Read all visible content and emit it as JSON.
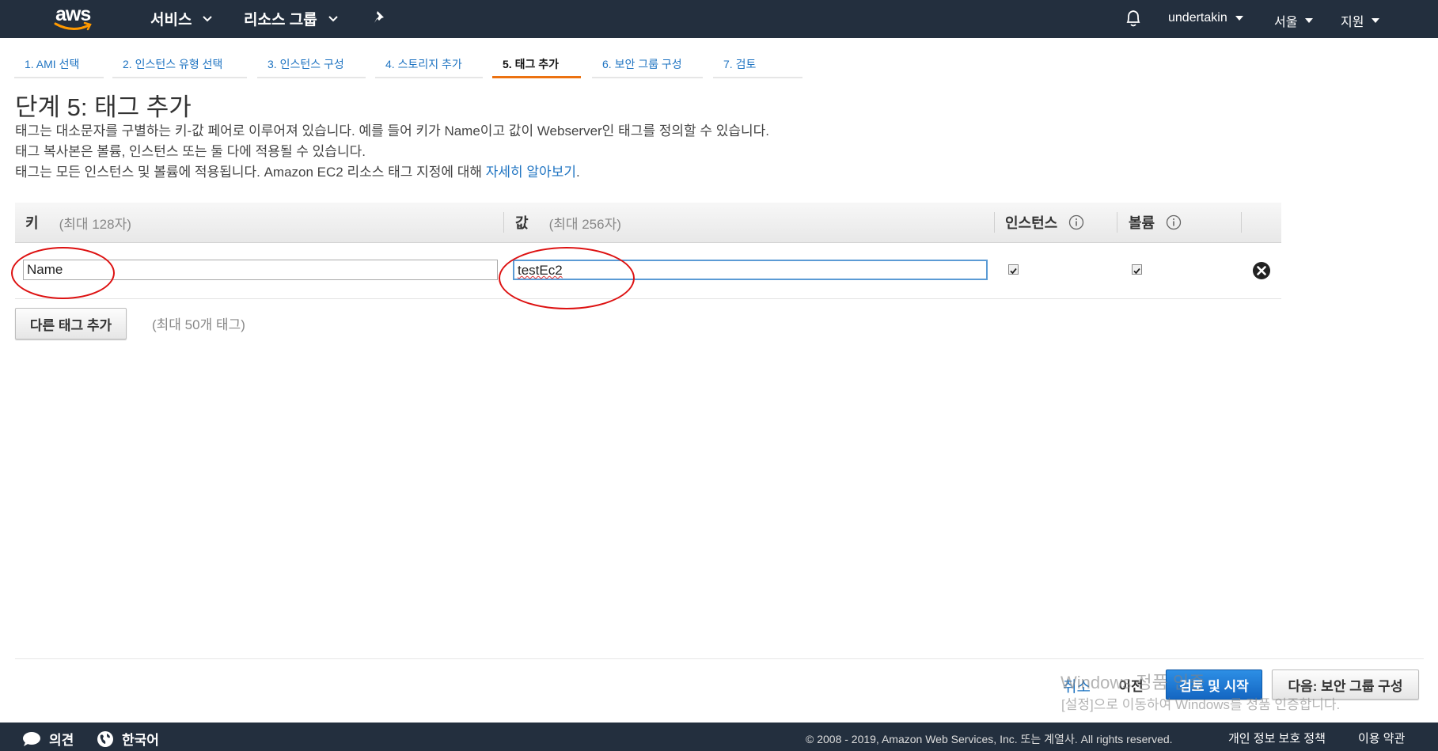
{
  "nav": {
    "brand": "aws",
    "services": "서비스",
    "resource_groups": "리소스 그룹",
    "user": "undertakin",
    "region": "서울",
    "support": "지원"
  },
  "steps": [
    {
      "label": "1. AMI 선택",
      "active": false
    },
    {
      "label": "2. 인스턴스 유형 선택",
      "active": false
    },
    {
      "label": "3. 인스턴스 구성",
      "active": false
    },
    {
      "label": "4. 스토리지 추가",
      "active": false
    },
    {
      "label": "5. 태그 추가",
      "active": true
    },
    {
      "label": "6. 보안 그룹 구성",
      "active": false
    },
    {
      "label": "7. 검토",
      "active": false
    }
  ],
  "page": {
    "title": "단계 5: 태그 추가",
    "desc1": "태그는 대소문자를 구별하는 키-값 페어로 이루어져 있습니다. 예를 들어 키가 Name이고 값이 Webserver인 태그를 정의할 수 있습니다.",
    "desc2": "태그 복사본은 볼륨, 인스턴스 또는 둘 다에 적용될 수 있습니다.",
    "desc3": "태그는 모든 인스턴스 및 볼륨에 적용됩니다. Amazon EC2 리소스 태그 지정에 대해 ",
    "learn_more": "자세히 알아보기",
    "desc3_end": "."
  },
  "table": {
    "key_header": "키",
    "key_hint": "(최대 128자)",
    "value_header": "값",
    "value_hint": "(최대 256자)",
    "instances_header": "인스턴스",
    "volumes_header": "볼륨",
    "rows": [
      {
        "key": "Name",
        "value": "testEc2",
        "instances": true,
        "volumes": true
      }
    ]
  },
  "add_tag": {
    "button": "다른 태그 추가",
    "note": "(최대 50개 태그)"
  },
  "actions": {
    "cancel": "취소",
    "previous": "이전",
    "review_launch": "검토 및 시작",
    "next": "다음: 보안 그룹 구성"
  },
  "watermark": {
    "line1": "Windows 정품 인증",
    "line2": "[설정]으로 이동하여 Windows를 정품 인증합니다."
  },
  "footer": {
    "feedback": "의견",
    "language": "한국어",
    "copyright": "© 2008 - 2019, Amazon Web Services, Inc. 또는 계열사. All rights reserved.",
    "privacy": "개인 정보 보호 정책",
    "terms": "이용 약관"
  },
  "colors": {
    "nav_bg": "#232f3e",
    "link": "#1f74c2",
    "active_tab": "#ec7211",
    "primary_button": "#1466c2",
    "annotation": "#dd1111"
  }
}
